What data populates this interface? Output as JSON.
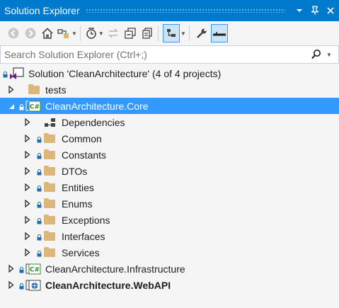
{
  "window": {
    "title": "Solution Explorer"
  },
  "search": {
    "placeholder": "Search Solution Explorer (Ctrl+;)"
  },
  "toolbar_icons": [
    "back-icon",
    "forward-icon",
    "home-icon",
    "switch-views-icon",
    "pending-changes-filter-icon",
    "sync-icon",
    "collapse-all-icon",
    "show-all-files-icon",
    "preview-selected-icon",
    "properties-icon",
    "pin-active-icon"
  ],
  "tree": {
    "solution": "Solution 'CleanArchitecture' (4 of 4 projects)",
    "tests": "tests",
    "core": "CleanArchitecture.Core",
    "core_children": {
      "dependencies": "Dependencies",
      "common": "Common",
      "constants": "Constants",
      "dtos": "DTOs",
      "entities": "Entities",
      "enums": "Enums",
      "exceptions": "Exceptions",
      "interfaces": "Interfaces",
      "services": "Services"
    },
    "infrastructure": "CleanArchitecture.Infrastructure",
    "webapi": "CleanArchitecture.WebAPI"
  },
  "colors": {
    "title_bar": "#007acc",
    "selection": "#3399ff",
    "folder": "#dcb67a",
    "csharp": "#388a34"
  }
}
